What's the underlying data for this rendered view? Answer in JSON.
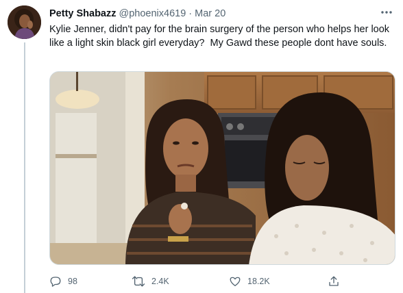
{
  "tweet": {
    "display_name": "Petty Shabazz",
    "handle": "@phoenix4619",
    "separator": "·",
    "date": "Mar 20",
    "text": "Kylie Jenner, didn't pay for the brain surgery of the person who helps her look like a light skin black girl everyday?  My Gawd these people dont have souls."
  },
  "actions": {
    "replies": "98",
    "retweets": "2.4K",
    "likes": "18.2K"
  },
  "icons": {
    "more": "more-horizontal-icon",
    "reply": "reply-icon",
    "retweet": "retweet-icon",
    "like": "heart-icon",
    "share": "share-icon"
  },
  "colors": {
    "text": "#0f1419",
    "secondary": "#536471",
    "border": "#cfd9de",
    "thread_line": "#c4cfd6"
  }
}
